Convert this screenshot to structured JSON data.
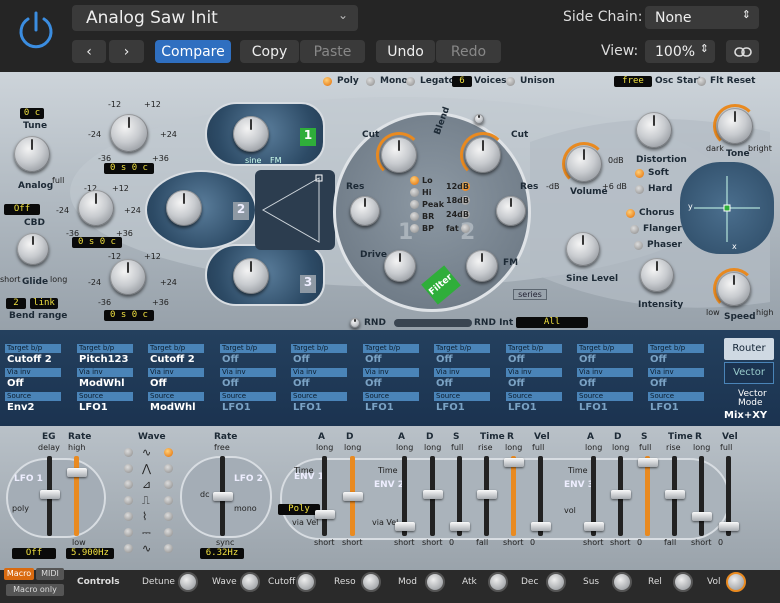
{
  "header": {
    "preset_name": "Analog Saw Init",
    "compare_label": "Compare",
    "copy_label": "Copy",
    "paste_label": "Paste",
    "undo_label": "Undo",
    "redo_label": "Redo",
    "side_chain_label": "Side Chain:",
    "side_chain_value": "None",
    "view_label": "View:",
    "view_value": "100%"
  },
  "voice": {
    "poly": "Poly",
    "mono": "Mono",
    "legato": "Legato",
    "voices_value": "6",
    "voices_label": "Voices",
    "unison": "Unison",
    "osc_start_value": "free",
    "osc_start_label": "Osc Start",
    "flt_reset": "Flt Reset"
  },
  "osc_left": {
    "tune_value": "0 c",
    "tune_label": "Tune",
    "analog_label": "Analog",
    "full": "full",
    "cbd_value": "Off",
    "cbd_label": "CBD",
    "glide_label": "Glide",
    "short": "short",
    "long": "long",
    "bend_value": "2",
    "bend_link": "link",
    "bend_label": "Bend range"
  },
  "oscillators": [
    {
      "num": "1",
      "value": "0 s  0 c",
      "wave_label": "sine",
      "fm": "FM"
    },
    {
      "num": "2",
      "value": "0 s  0 c",
      "wave_label": "",
      "fm": ""
    },
    {
      "num": "3",
      "value": "0 s  0 c",
      "wave_label": "",
      "fm": ""
    }
  ],
  "scale": {
    "n12": "-12",
    "p12": "+12",
    "n24": "-24",
    "p24": "+24",
    "n36": "-36",
    "p36": "+36",
    "zero": "0"
  },
  "filter": {
    "blend": "Blend",
    "cut": "Cut",
    "res": "Res",
    "drive": "Drive",
    "fm": "FM",
    "filter_label": "Filter",
    "series": "series",
    "modes1": [
      "Lo",
      "Hi",
      "Peak",
      "BR",
      "BP"
    ],
    "modes2": [
      "12dB",
      "18dB",
      "24dB",
      "fat"
    ],
    "num1": "1",
    "num2": "2"
  },
  "output": {
    "distortion": "Distortion",
    "tone": "Tone",
    "dark": "dark",
    "bright": "bright",
    "soft": "Soft",
    "hard": "Hard",
    "volume": "Volume",
    "vol_min": "-dB",
    "vol_mid": "0dB",
    "vol_max": "+6 dB",
    "chorus": "Chorus",
    "flanger": "Flanger",
    "phaser": "Phaser",
    "sine_level": "Sine Level",
    "intensity": "Intensity",
    "speed": "Speed",
    "low": "low",
    "high": "high",
    "x": "x",
    "y": "y"
  },
  "rnd": {
    "rnd": "RND",
    "rnd_int": "RND Int",
    "all": "All"
  },
  "matrix": {
    "slots": [
      {
        "target": "Cutoff 2",
        "via": "Off",
        "source": "Env2"
      },
      {
        "target": "Pitch123",
        "via": "ModWhl",
        "source": "LFO1"
      },
      {
        "target": "Cutoff 2",
        "via": "Off",
        "source": "ModWhl"
      },
      {
        "target": "Off",
        "via": "Off",
        "source": "LFO1"
      },
      {
        "target": "Off",
        "via": "Off",
        "source": "LFO1"
      },
      {
        "target": "Off",
        "via": "Off",
        "source": "LFO1"
      },
      {
        "target": "Off",
        "via": "Off",
        "source": "LFO1"
      },
      {
        "target": "Off",
        "via": "Off",
        "source": "LFO1"
      },
      {
        "target": "Off",
        "via": "Off",
        "source": "LFO1"
      },
      {
        "target": "Off",
        "via": "Off",
        "source": "LFO1"
      }
    ],
    "target_hd": "Target",
    "bp": "b/p",
    "via_hd": "Via",
    "inv": "inv",
    "source_hd": "Source",
    "router": "Router",
    "vector": "Vector",
    "vector_mode": "Vector Mode",
    "vector_mode_value": "Mix+XY"
  },
  "lfo": {
    "eg": "EG",
    "delay": "delay",
    "rate": "Rate",
    "high": "high",
    "low": "low",
    "lfo1": "LFO 1",
    "poly": "poly",
    "lfo1_value": "Off",
    "lfo1_rate": "5.900Hz",
    "wave": "Wave",
    "rate2": "Rate",
    "free": "free",
    "sync": "sync",
    "lfo2": "LFO 2",
    "mono": "mono",
    "dc": "dc",
    "lfo2_rate": "6.32Hz"
  },
  "env": {
    "A": "A",
    "D": "D",
    "S": "S",
    "R": "R",
    "time": "Time",
    "vel": "Vel",
    "long": "long",
    "short": "short",
    "full": "full",
    "rise": "rise",
    "fall": "fall",
    "zero": "0",
    "env1": "ENV 1",
    "env2": "ENV 2",
    "env3": "ENV 3",
    "env1_mode": "Poly",
    "via_vel": "via Vel",
    "vol": "vol"
  },
  "controls": {
    "macro": "Macro",
    "midi": "MIDI",
    "macro_only": "Macro only",
    "title": "Controls",
    "knobs": [
      "Detune",
      "Wave",
      "Cutoff",
      "Reso",
      "Mod",
      "Atk",
      "Dec",
      "Sus",
      "Rel",
      "Vol"
    ]
  }
}
